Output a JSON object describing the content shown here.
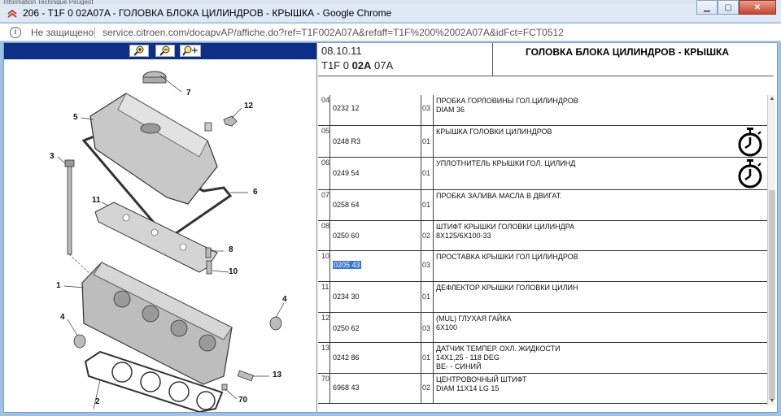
{
  "window": {
    "top_strip": "Information Technique Peugeot",
    "title": "206 - T1F 0 02A07A - ГОЛОВКА БЛОКА ЦИЛИНДРОВ - КРЫШКА - Google Chrome",
    "minimize": "▁",
    "maximize": "▢",
    "close": "✕"
  },
  "address_bar": {
    "security": "Не защищено",
    "url": "service.citroen.com/docapvAP/affiche.do?ref=T1F002A07A&refaff=T1F%200%2002A07A&idFct=FCT0512"
  },
  "toolbar": {
    "zoom_in_icon": "magnifier-plus-icon",
    "zoom_out_icon": "magnifier-minus-icon",
    "pan_icon": "magnifier-move-icon"
  },
  "diagram": {
    "callouts": [
      "7",
      "5",
      "12",
      "3",
      "6",
      "11",
      "8",
      "10",
      "1",
      "4",
      "4",
      "2",
      "13",
      "70"
    ]
  },
  "header": {
    "date": "08.10.11",
    "code_pre": "T1F 0 ",
    "code_bold": "02A",
    "code_post": " 07A",
    "title": "ГОЛОВКА БЛОКА ЦИЛИНДРОВ - КРЫШКА"
  },
  "rows": [
    {
      "num": "04",
      "part": "0232 12",
      "qty": "03",
      "desc1": "ПРОБКА ГОРЛОВИНЫ ГОЛ.ЦИЛИНДРОВ",
      "desc2": "DIAM 36",
      "desc3": ""
    },
    {
      "num": "05",
      "part": "0248 R3",
      "qty": "01",
      "desc1": "КРЫШКА ГОЛОВКИ ЦИЛИНДРОВ",
      "desc2": "",
      "desc3": ""
    },
    {
      "num": "06",
      "part": "0249 54",
      "qty": "01",
      "desc1": "УПЛОТНИТЕЛЬ КРЫШКИ ГОЛ. ЦИЛИНД",
      "desc2": "",
      "desc3": ""
    },
    {
      "num": "07",
      "part": "0258 64",
      "qty": "01",
      "desc1": "ПРОБКА ЗАЛИВА МАСЛА В ДВИГАТ.",
      "desc2": "",
      "desc3": ""
    },
    {
      "num": "08",
      "part": "0250 60",
      "qty": "02",
      "desc1": "ШТИФТ КРЫШКИ ГОЛОВКИ ЦИЛИНДРА",
      "desc2": "8X125/6X100-33",
      "desc3": ""
    },
    {
      "num": "10",
      "part": "0205 43",
      "qty": "03",
      "desc1": "ПРОСТАВКА КРЫШКИ ГОЛ ЦИЛИНДРОВ",
      "desc2": "",
      "desc3": ""
    },
    {
      "num": "11",
      "part": "0234 30",
      "qty": "01",
      "desc1": "ДЕФЛЕКТОР КРЫШКИ ГОЛОВКИ ЦИЛИН",
      "desc2": "",
      "desc3": ""
    },
    {
      "num": "12",
      "part": "0250 62",
      "qty": "03",
      "desc1": "(MUL) ГЛУХАЯ ГАЙКА",
      "desc2": "6X100",
      "desc3": ""
    },
    {
      "num": "13",
      "part": "0242 86",
      "qty": "01",
      "desc1": "ДАТЧИК ТЕМПЕР. ОХЛ. ЖИДКОСТИ",
      "desc2": "14X1,25 - 118 DEG",
      "desc3": "BE- - СИНИЙ"
    },
    {
      "num": "70",
      "part": "6968 43",
      "qty": "02",
      "desc1": "ЦЕНТРОВОЧНЫЙ ШТИФТ",
      "desc2": "DIAM 11X14 LG 15",
      "desc3": ""
    }
  ],
  "scroll": {
    "up": "▲",
    "down": "▼"
  }
}
